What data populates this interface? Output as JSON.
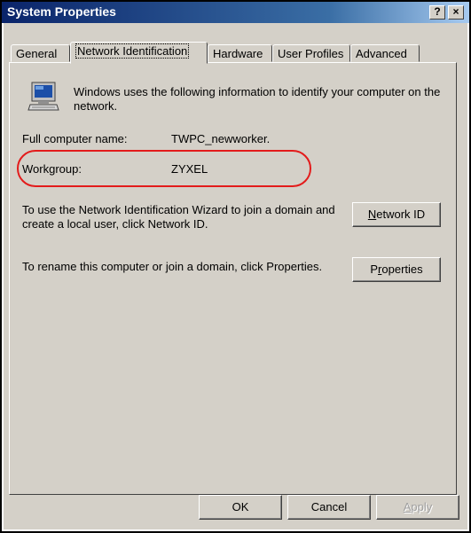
{
  "window": {
    "title": "System Properties",
    "help_glyph": "?",
    "close_glyph": "×"
  },
  "tabs": [
    {
      "label": "General",
      "active": false
    },
    {
      "label": "Network Identification",
      "active": true
    },
    {
      "label": "Hardware",
      "active": false
    },
    {
      "label": "User Profiles",
      "active": false
    },
    {
      "label": "Advanced",
      "active": false
    }
  ],
  "network": {
    "intro": "Windows uses the following information to identify your computer on the network.",
    "full_name_label": "Full computer name:",
    "full_name_value": "TWPC_newworker.",
    "workgroup_label": "Workgroup:",
    "workgroup_value": "ZYXEL",
    "network_id_text": "To use the Network Identification Wizard to join a domain and create a local user, click Network ID.",
    "network_id_button": {
      "accel": "N",
      "rest": "etwork ID"
    },
    "properties_text": "To rename this computer or join a domain, click Properties.",
    "properties_button": {
      "pre": "P",
      "accel": "r",
      "rest": "operties"
    }
  },
  "footer": {
    "ok": "OK",
    "cancel": "Cancel",
    "apply": {
      "accel": "A",
      "rest": "pply"
    },
    "apply_enabled": false
  },
  "colors": {
    "highlight": "#e31b1b",
    "titlebar": "#0a246a",
    "face": "#d4d0c8"
  },
  "icons": {
    "computer": "computer-icon"
  }
}
